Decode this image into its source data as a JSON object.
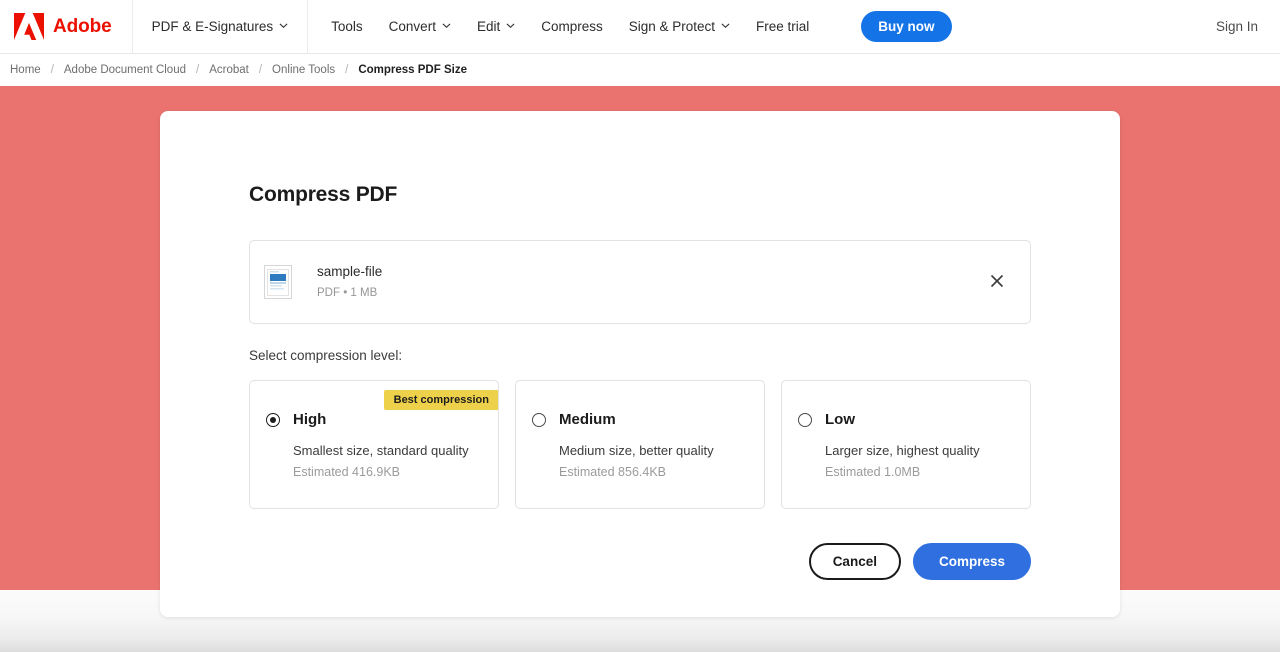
{
  "header": {
    "brand_name": "Adobe",
    "logo_icon": "adobe-logo-icon",
    "nav": [
      {
        "label": "PDF & E-Signatures",
        "has_dropdown": true
      },
      {
        "label": "Tools",
        "has_dropdown": false
      },
      {
        "label": "Convert",
        "has_dropdown": true
      },
      {
        "label": "Edit",
        "has_dropdown": true
      },
      {
        "label": "Compress",
        "has_dropdown": false
      },
      {
        "label": "Sign & Protect",
        "has_dropdown": true
      },
      {
        "label": "Free trial",
        "has_dropdown": false
      }
    ],
    "buy_now_label": "Buy now",
    "sign_in_label": "Sign In",
    "accent_blue": "#1473e6"
  },
  "breadcrumb": {
    "separator": "/",
    "items": [
      {
        "label": "Home",
        "current": false
      },
      {
        "label": "Adobe Document Cloud",
        "current": false
      },
      {
        "label": "Acrobat",
        "current": false
      },
      {
        "label": "Online Tools",
        "current": false
      },
      {
        "label": "Compress PDF Size",
        "current": true
      }
    ]
  },
  "stage": {
    "background_color": "#ea7370"
  },
  "tool": {
    "title": "Compress PDF",
    "file": {
      "thumbnail_icon": "pdf-page-thumbnail-icon",
      "name": "sample-file",
      "meta": "PDF • 1 MB",
      "remove_icon": "close-icon"
    },
    "section_label": "Select compression level:",
    "options": [
      {
        "name": "High",
        "description": "Smallest size, standard quality",
        "estimate": "Estimated 416.9KB",
        "badge": "Best compression",
        "selected": true
      },
      {
        "name": "Medium",
        "description": "Medium size, better quality",
        "estimate": "Estimated 856.4KB",
        "badge": "",
        "selected": false
      },
      {
        "name": "Low",
        "description": "Larger size, highest quality",
        "estimate": "Estimated 1.0MB",
        "badge": "",
        "selected": false
      }
    ],
    "badge_color": "#eed14a",
    "cancel_label": "Cancel",
    "compress_label": "Compress",
    "compress_color": "#2f6fdf"
  }
}
